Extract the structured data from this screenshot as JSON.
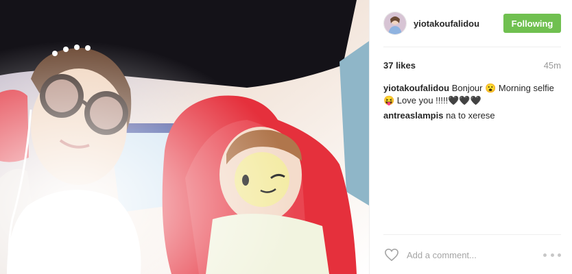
{
  "post": {
    "photo_icon": "selfie-photo",
    "author": {
      "username": "yiotakoufalidou",
      "avatar_icon": "profile-avatar"
    },
    "follow_button_label": "Following",
    "follow_button_color": "#70c050",
    "likes": "37 likes",
    "time": "45m",
    "comments": [
      {
        "user": "yiotakoufalidou",
        "text": "Bonjour 😮 Morning selfie 😝 Love you !!!!!🖤🖤🖤"
      },
      {
        "user": "antreaslampis",
        "text": "na to xerese"
      }
    ],
    "add_comment_placeholder": "Add a comment...",
    "like_icon": "heart-outline-icon",
    "more_icon": "ellipsis-icon"
  }
}
